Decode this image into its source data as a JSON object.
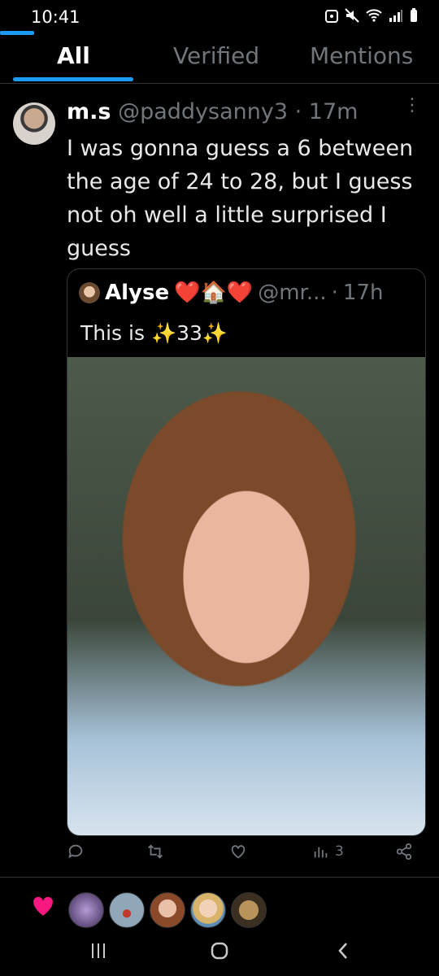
{
  "status": {
    "time": "10:41"
  },
  "tabs": [
    {
      "label": "All"
    },
    {
      "label": "Verified"
    },
    {
      "label": "Mentions"
    }
  ],
  "tweet": {
    "name": "m.s",
    "handle": "@paddysanny3",
    "separator": "·",
    "time": "17m",
    "text": "I was gonna guess a 6 between the age of 24 to 28, but I guess not oh well a little surprised I guess",
    "quote": {
      "name": "Alyse",
      "emoji": "❤️🏠❤️",
      "handle": "@mr...",
      "separator": "·",
      "time": "17h",
      "text": "This is ✨33✨"
    },
    "actions": {
      "views_count": "3"
    }
  },
  "colors": {
    "accent": "#1d9bf0",
    "heart": "#f91880",
    "muted": "#71767b"
  }
}
